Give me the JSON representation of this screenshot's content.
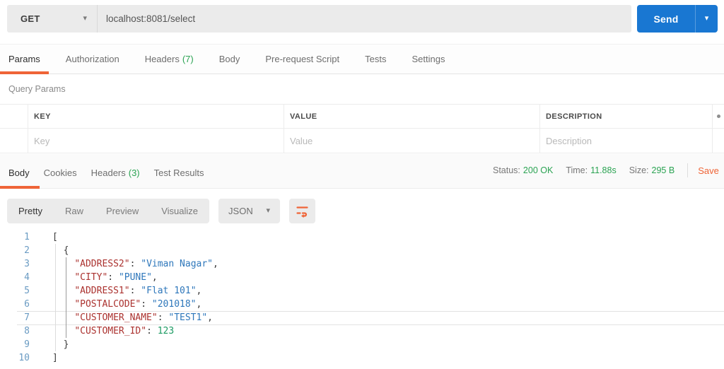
{
  "request_bar": {
    "method": "GET",
    "url": "localhost:8081/select",
    "send_label": "Send"
  },
  "request_tabs": [
    {
      "label": "Params",
      "active": true
    },
    {
      "label": "Authorization"
    },
    {
      "label": "Headers",
      "count": "(7)"
    },
    {
      "label": "Body"
    },
    {
      "label": "Pre-request Script"
    },
    {
      "label": "Tests"
    },
    {
      "label": "Settings"
    }
  ],
  "params": {
    "section_title": "Query Params",
    "headers": [
      "KEY",
      "VALUE",
      "DESCRIPTION"
    ],
    "row_placeholders": {
      "key": "Key",
      "value": "Value",
      "description": "Description"
    }
  },
  "response": {
    "tabs": [
      {
        "label": "Body",
        "active": true
      },
      {
        "label": "Cookies"
      },
      {
        "label": "Headers",
        "count": "(3)"
      },
      {
        "label": "Test Results"
      }
    ],
    "meta": [
      {
        "label": "Status:",
        "value": "200 OK"
      },
      {
        "label": "Time:",
        "value": "11.88s"
      },
      {
        "label": "Size:",
        "value": "295 B"
      }
    ],
    "save_label": "Save",
    "view_modes": [
      {
        "label": "Pretty",
        "active": true
      },
      {
        "label": "Raw"
      },
      {
        "label": "Preview"
      },
      {
        "label": "Visualize"
      }
    ],
    "format": "JSON",
    "code": {
      "highlighted_line": 7,
      "lines": [
        {
          "num": "1",
          "indent": "",
          "tokens": [
            {
              "t": "punct",
              "v": "["
            }
          ]
        },
        {
          "num": "2",
          "indent": "  ",
          "tokens": [
            {
              "t": "punct",
              "v": "{"
            }
          ]
        },
        {
          "num": "3",
          "indent": "    ",
          "tokens": [
            {
              "t": "key",
              "v": "\"ADDRESS2\""
            },
            {
              "t": "punct",
              "v": ": "
            },
            {
              "t": "str",
              "v": "\"Viman Nagar\""
            },
            {
              "t": "punct",
              "v": ","
            }
          ]
        },
        {
          "num": "4",
          "indent": "    ",
          "tokens": [
            {
              "t": "key",
              "v": "\"CITY\""
            },
            {
              "t": "punct",
              "v": ": "
            },
            {
              "t": "str",
              "v": "\"PUNE\""
            },
            {
              "t": "punct",
              "v": ","
            }
          ]
        },
        {
          "num": "5",
          "indent": "    ",
          "tokens": [
            {
              "t": "key",
              "v": "\"ADDRESS1\""
            },
            {
              "t": "punct",
              "v": ": "
            },
            {
              "t": "str",
              "v": "\"Flat 101\""
            },
            {
              "t": "punct",
              "v": ","
            }
          ]
        },
        {
          "num": "6",
          "indent": "    ",
          "tokens": [
            {
              "t": "key",
              "v": "\"POSTALCODE\""
            },
            {
              "t": "punct",
              "v": ": "
            },
            {
              "t": "str",
              "v": "\"201018\""
            },
            {
              "t": "punct",
              "v": ","
            }
          ]
        },
        {
          "num": "7",
          "indent": "    ",
          "tokens": [
            {
              "t": "key",
              "v": "\"CUSTOMER_NAME\""
            },
            {
              "t": "punct",
              "v": ": "
            },
            {
              "t": "str",
              "v": "\"TEST1\""
            },
            {
              "t": "punct",
              "v": ","
            }
          ]
        },
        {
          "num": "8",
          "indent": "    ",
          "tokens": [
            {
              "t": "key",
              "v": "\"CUSTOMER_ID\""
            },
            {
              "t": "punct",
              "v": ": "
            },
            {
              "t": "num",
              "v": "123"
            }
          ]
        },
        {
          "num": "9",
          "indent": "  ",
          "tokens": [
            {
              "t": "punct",
              "v": "}"
            }
          ]
        },
        {
          "num": "10",
          "indent": "",
          "tokens": [
            {
              "t": "punct",
              "v": "]"
            }
          ]
        }
      ]
    }
  },
  "colors": {
    "orange": "#ef6437",
    "green": "#2aa352",
    "send-blue": "#1977d2",
    "json-key": "#ab322f",
    "json-str": "#2e77bb",
    "json-num": "#1d9b63",
    "line-num": "#6a9bc3"
  }
}
